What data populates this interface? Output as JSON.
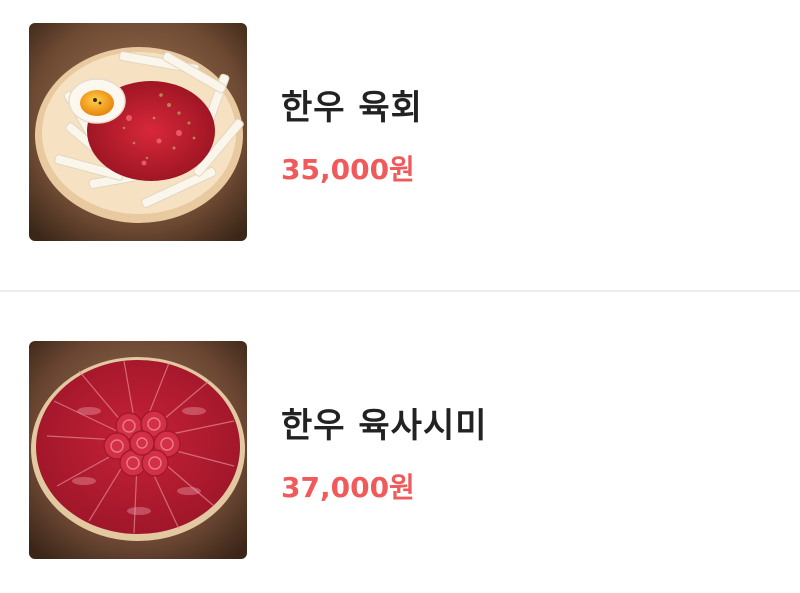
{
  "colors": {
    "price": "#f05a5a",
    "name": "#222222",
    "divider": "#ececec"
  },
  "menu": {
    "items": [
      {
        "name": "한우 육회",
        "price": "35,000원",
        "image": "beef-tartare-photo"
      },
      {
        "name": "한우 육사시미",
        "price": "37,000원",
        "image": "beef-sashimi-photo"
      }
    ]
  }
}
